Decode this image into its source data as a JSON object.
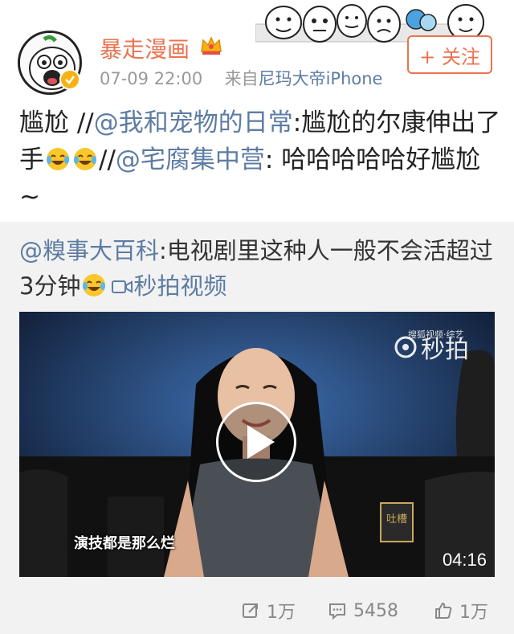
{
  "post": {
    "username": "暴走漫画",
    "time": "07-09 22:00",
    "source_prefix": "来自",
    "source_device": "尼玛大帝iPhone",
    "follow_label": "+ 关注"
  },
  "repost": {
    "t1": "尴尬 //",
    "m1": "@我和宠物的日常",
    "t2": ":尴尬的尔康伸出了手",
    "t3": "//",
    "m2": "@宅腐集中营",
    "t4": ": 哈哈哈哈哈好尴尬~"
  },
  "original": {
    "mention": "@糗事大百科",
    "text": ":电视剧里这种人一般不会活超过3分钟",
    "video_label": "秒拍视频"
  },
  "video": {
    "duration": "04:16",
    "subtitle": "演技都是那么烂",
    "watermark": "秒拍",
    "watermark_small": "搜狐视频·综艺"
  },
  "actions": {
    "repost_count": "1万",
    "comment_count": "5458",
    "like_count": "1万"
  },
  "colors": {
    "accent": "#eb7350",
    "link": "#5d7ca3",
    "meta": "#999999",
    "panel": "#f2f2f2"
  }
}
